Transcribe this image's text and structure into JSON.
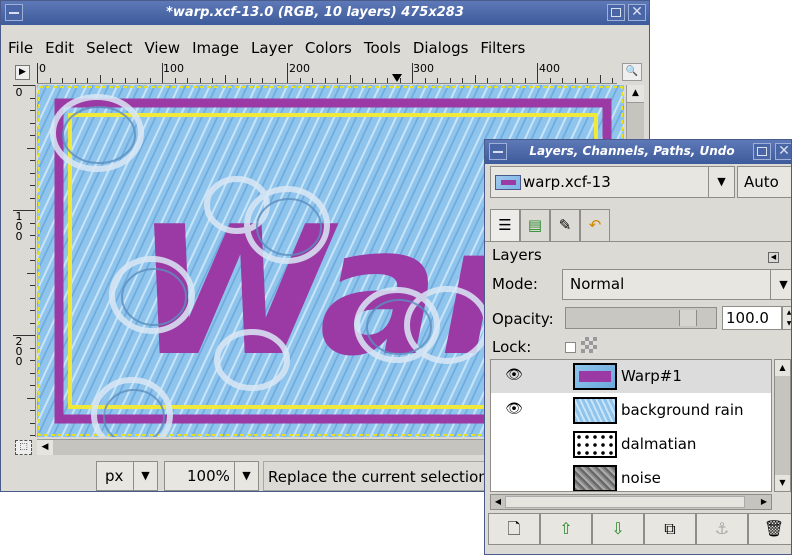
{
  "image_window": {
    "title": "*warp.xcf-13.0 (RGB, 10 layers) 475x283",
    "menu": [
      "File",
      "Edit",
      "Select",
      "View",
      "Image",
      "Layer",
      "Colors",
      "Tools",
      "Dialogs",
      "Filters"
    ],
    "hruler_labels": [
      "0",
      "100",
      "200",
      "300",
      "400"
    ],
    "vruler_labels": [
      "0",
      "100",
      "200"
    ],
    "canvas_text": "Warp",
    "status": {
      "unit": "px",
      "zoom": "100%",
      "message": "Replace the current selection"
    }
  },
  "dock": {
    "title": "Layers, Channels, Paths, Undo",
    "image_name": "warp.xcf-13",
    "auto_label": "Auto",
    "tabs": [
      "layers-tab",
      "channels-tab",
      "paths-tab",
      "undo-tab"
    ],
    "section_title": "Layers",
    "mode_label": "Mode:",
    "mode_value": "Normal",
    "opacity_label": "Opacity:",
    "opacity_value": "100.0",
    "lock_label": "Lock:",
    "layers": [
      {
        "name": "Warp#1",
        "visible": true,
        "selected": true
      },
      {
        "name": "background rain",
        "visible": true,
        "selected": false
      },
      {
        "name": "dalmatian",
        "visible": false,
        "selected": false
      },
      {
        "name": "noise",
        "visible": false,
        "selected": false
      }
    ],
    "buttons": [
      "new-layer",
      "raise-layer",
      "lower-layer",
      "duplicate-layer",
      "anchor-layer",
      "delete-layer"
    ]
  },
  "colors": {
    "titlebar": "#4b66a6",
    "canvas_bg": "#8fc4ec",
    "purple": "#9b3aa5",
    "yellow": "#f0e83a"
  }
}
